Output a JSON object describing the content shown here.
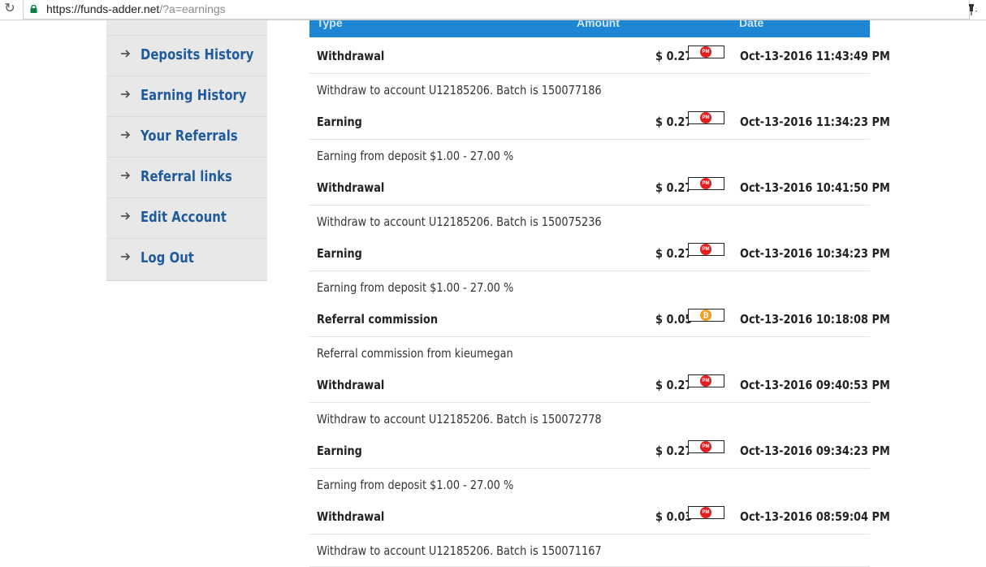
{
  "browser": {
    "url_host": "https://funds-adder.net",
    "url_path": "/?a=earnings"
  },
  "sidebar": {
    "items": [
      {
        "label": "Deposits History"
      },
      {
        "label": "Earning History"
      },
      {
        "label": "Your Referrals"
      },
      {
        "label": "Referral links"
      },
      {
        "label": "Edit Account"
      },
      {
        "label": "Log Out"
      }
    ]
  },
  "table": {
    "headers": {
      "type": "Type",
      "amount": "Amount",
      "date": "Date"
    },
    "colors": {
      "header_bg": "#1d87d5",
      "pm": "#e02020",
      "btc": "#f0a020"
    },
    "rows": [
      {
        "type": "Withdrawal",
        "amount": "$ 0.27",
        "method": "PM",
        "date": "Oct-13-2016 11:43:49 PM",
        "desc": "Withdraw to account U12185206. Batch is 150077186"
      },
      {
        "type": "Earning",
        "amount": "$ 0.27",
        "method": "PM",
        "date": "Oct-13-2016 11:34:23 PM",
        "desc": "Earning from deposit $1.00 - 27.00 %"
      },
      {
        "type": "Withdrawal",
        "amount": "$ 0.27",
        "method": "PM",
        "date": "Oct-13-2016 10:41:50 PM",
        "desc": "Withdraw to account U12185206. Batch is 150075236"
      },
      {
        "type": "Earning",
        "amount": "$ 0.27",
        "method": "PM",
        "date": "Oct-13-2016 10:34:23 PM",
        "desc": "Earning from deposit $1.00 - 27.00 %"
      },
      {
        "type": "Referral commission",
        "amount": "$ 0.05",
        "method": "BTC",
        "date": "Oct-13-2016 10:18:08 PM",
        "desc": "Referral commission from kieumegan"
      },
      {
        "type": "Withdrawal",
        "amount": "$ 0.27",
        "method": "PM",
        "date": "Oct-13-2016 09:40:53 PM",
        "desc": "Withdraw to account U12185206. Batch is 150072778"
      },
      {
        "type": "Earning",
        "amount": "$ 0.27",
        "method": "PM",
        "date": "Oct-13-2016 09:34:23 PM",
        "desc": "Earning from deposit $1.00 - 27.00 %"
      },
      {
        "type": "Withdrawal",
        "amount": "$ 0.03",
        "method": "PM",
        "date": "Oct-13-2016 08:59:04 PM",
        "desc": "Withdraw to account U12185206. Batch is 150071167"
      }
    ]
  }
}
